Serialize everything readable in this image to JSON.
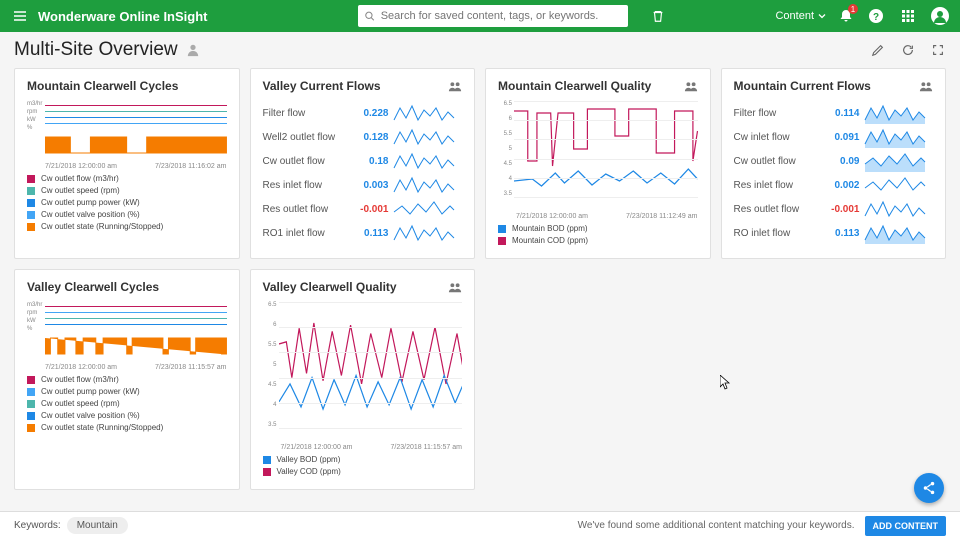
{
  "header": {
    "brand": "Wonderware Online InSight",
    "search_placeholder": "Search for saved content, tags, or keywords.",
    "content_label": "Content",
    "badge": "1"
  },
  "page": {
    "title": "Multi-Site Overview"
  },
  "colors": {
    "green": "#1e9e3e",
    "blue": "#1e88e5",
    "red": "#c62828",
    "orange": "#f57c00",
    "teal": "#4db6ac",
    "pink": "#c2185b",
    "lblue": "#42a5f5"
  },
  "cards": {
    "mountain_cycles": {
      "title": "Mountain Clearwell Cycles",
      "axis": [
        "m3/hr",
        "rpm",
        "kW",
        "%"
      ],
      "time_start": "7/21/2018 12:00:00 am",
      "time_end": "7/23/2018 11:16:02 am",
      "legend": [
        {
          "label": "Cw outlet flow (m3/hr)",
          "color": "#c2185b"
        },
        {
          "label": "Cw outlet speed (rpm)",
          "color": "#4db6ac"
        },
        {
          "label": "Cw outlet pump power (kW)",
          "color": "#1e88e5"
        },
        {
          "label": "Cw outlet valve position (%)",
          "color": "#42a5f5"
        },
        {
          "label": "Cw outlet state (Running/Stopped)",
          "color": "#f57c00"
        }
      ]
    },
    "valley_flows": {
      "title": "Valley Current Flows",
      "rows": [
        {
          "label": "Filter flow",
          "value": "0.228"
        },
        {
          "label": "Well2 outlet flow",
          "value": "0.128"
        },
        {
          "label": "Cw outlet flow",
          "value": "0.18"
        },
        {
          "label": "Res inlet flow",
          "value": "0.003"
        },
        {
          "label": "Res outlet flow",
          "value": "-0.001"
        },
        {
          "label": "RO1 inlet flow",
          "value": "0.113"
        }
      ]
    },
    "mountain_quality": {
      "title": "Mountain Clearwell Quality",
      "time_start": "7/21/2018 12:00:00 am",
      "time_end": "7/23/2018 11:12:49 am",
      "legend": [
        {
          "label": "Mountain BOD (ppm)",
          "color": "#1e88e5"
        },
        {
          "label": "Mountain COD (ppm)",
          "color": "#c2185b"
        }
      ],
      "yticks": [
        "6.5",
        "6",
        "5.5",
        "5",
        "4.5",
        "4",
        "3.5"
      ]
    },
    "mountain_flows": {
      "title": "Mountain Current Flows",
      "rows": [
        {
          "label": "Filter flow",
          "value": "0.114"
        },
        {
          "label": "Cw inlet flow",
          "value": "0.091"
        },
        {
          "label": "Cw outlet flow",
          "value": "0.09"
        },
        {
          "label": "Res inlet flow",
          "value": "0.002"
        },
        {
          "label": "Res outlet flow",
          "value": "-0.001"
        },
        {
          "label": "RO inlet flow",
          "value": "0.113"
        }
      ]
    },
    "valley_cycles": {
      "title": "Valley Clearwell Cycles",
      "axis": [
        "m3/hr",
        "rpm",
        "kW",
        "%"
      ],
      "time_start": "7/21/2018 12:00:00 am",
      "time_end": "7/23/2018 11:15:57 am",
      "legend": [
        {
          "label": "Cw outlet flow (m3/hr)",
          "color": "#c2185b"
        },
        {
          "label": "Cw outlet pump power (kW)",
          "color": "#42a5f5"
        },
        {
          "label": "Cw outlet speed (rpm)",
          "color": "#4db6ac"
        },
        {
          "label": "Cw outlet valve position (%)",
          "color": "#1e88e5"
        },
        {
          "label": "Cw outlet state (Running/Stopped)",
          "color": "#f57c00"
        }
      ]
    },
    "valley_quality": {
      "title": "Valley Clearwell Quality",
      "time_start": "7/21/2018 12:00:00 am",
      "time_end": "7/23/2018 11:15:57 am",
      "legend": [
        {
          "label": "Valley BOD (ppm)",
          "color": "#1e88e5"
        },
        {
          "label": "Valley COD (ppm)",
          "color": "#c2185b"
        }
      ],
      "yticks": [
        "6.5",
        "6",
        "5.5",
        "5",
        "4.5",
        "4",
        "3.5"
      ]
    }
  },
  "footer": {
    "keywords_label": "Keywords:",
    "chip": "Mountain",
    "message": "We've found some additional content matching your keywords.",
    "add_button": "ADD CONTENT"
  }
}
